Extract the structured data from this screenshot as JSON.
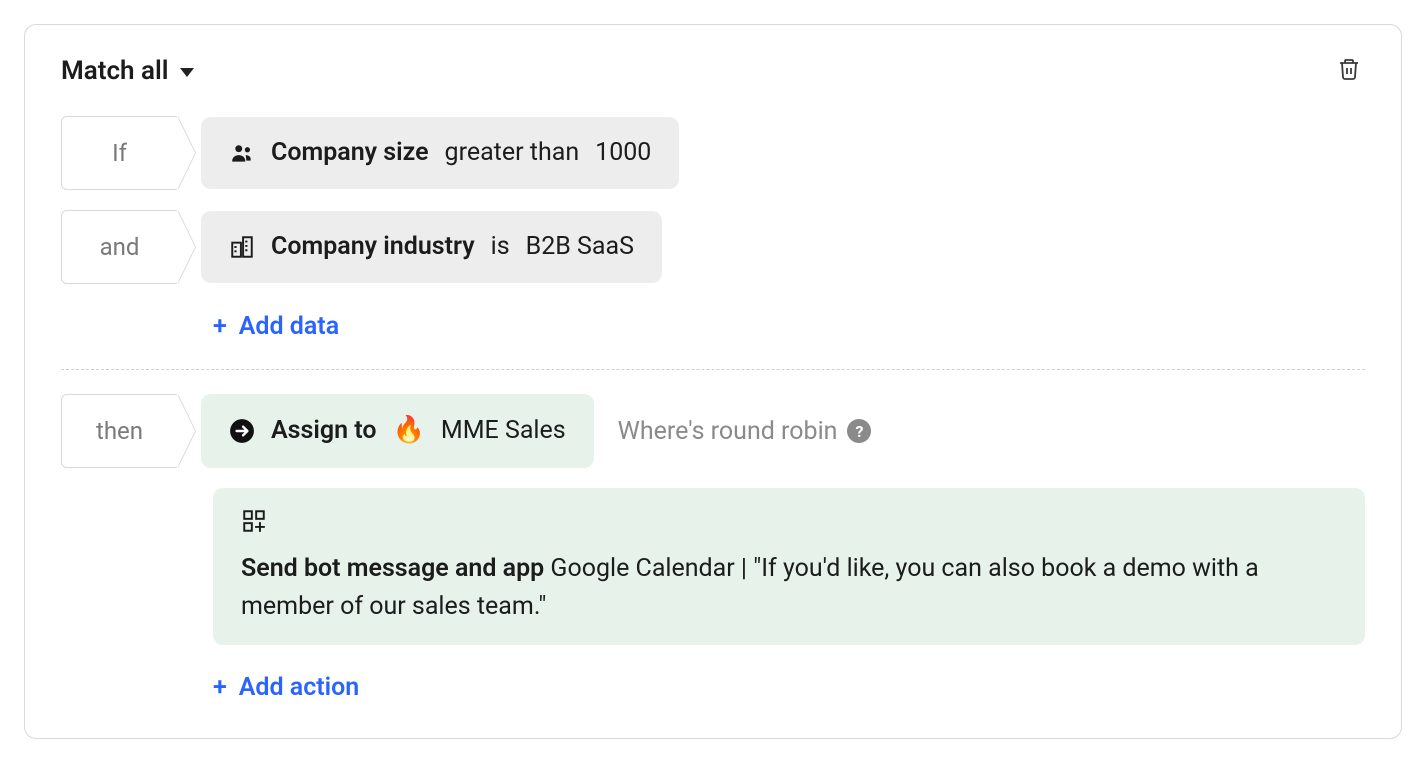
{
  "header": {
    "match_mode_label": "Match all"
  },
  "conditions": [
    {
      "tag": "If",
      "attribute": "Company size",
      "operator": "greater than",
      "value": "1000",
      "icon": "people-icon"
    },
    {
      "tag": "and",
      "attribute": "Company industry",
      "operator": "is",
      "value": "B2B SaaS",
      "icon": "buildings-icon"
    }
  ],
  "add_data_label": "Add data",
  "actions": {
    "tag": "then",
    "assign": {
      "label": "Assign to",
      "emoji": "🔥",
      "team": "MME Sales"
    },
    "hint": {
      "text": "Where's round robin",
      "help_char": "?"
    },
    "bot": {
      "label": "Send bot message and app",
      "app": "Google Calendar",
      "message": "\"If you'd like, you can also book a demo with a member of our sales team.\""
    },
    "add_action_label": "Add action"
  },
  "glyphs": {
    "plus": "+",
    "pipe": " | "
  }
}
